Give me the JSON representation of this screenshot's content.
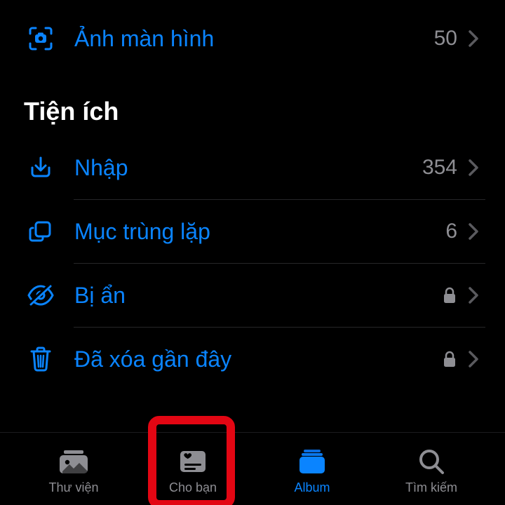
{
  "media_types": {
    "screenshots": {
      "label": "Ảnh màn hình",
      "count": "50"
    }
  },
  "utilities": {
    "header": "Tiện ích",
    "import": {
      "label": "Nhập",
      "count": "354"
    },
    "duplicates": {
      "label": "Mục trùng lặp",
      "count": "6"
    },
    "hidden": {
      "label": "Bị ẩn"
    },
    "deleted": {
      "label": "Đã xóa gần đây"
    }
  },
  "tabs": {
    "library": "Thư viện",
    "for_you": "Cho bạn",
    "albums": "Album",
    "search": "Tìm kiếm"
  }
}
